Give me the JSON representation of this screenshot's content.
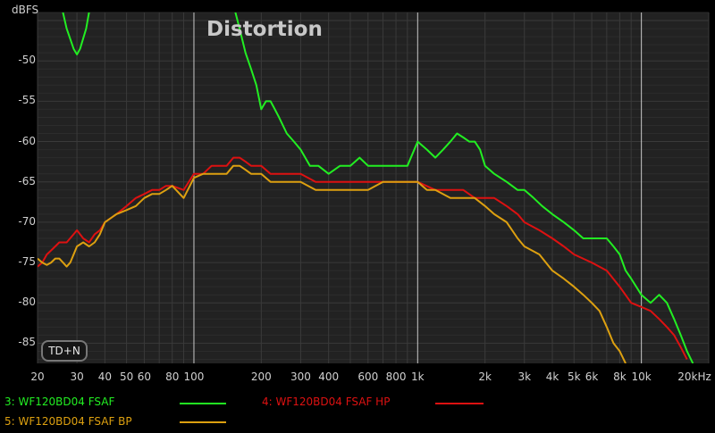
{
  "chart_data": {
    "type": "line",
    "title": "Distortion",
    "ylabel": "dBFS",
    "xlabel": "",
    "x_scale": "log",
    "xlim": [
      20,
      20000
    ],
    "ylim": [
      -87.5,
      -44
    ],
    "y_ticks": [
      "-50",
      "-55",
      "-60",
      "-65",
      "-70",
      "-75",
      "-80",
      "-85"
    ],
    "x_ticks": [
      {
        "v": 20,
        "label": "20"
      },
      {
        "v": 30,
        "label": "30"
      },
      {
        "v": 40,
        "label": "40"
      },
      {
        "v": 50,
        "label": "50"
      },
      {
        "v": 60,
        "label": "60"
      },
      {
        "v": 80,
        "label": "80"
      },
      {
        "v": 100,
        "label": "100"
      },
      {
        "v": 200,
        "label": "200"
      },
      {
        "v": 300,
        "label": "300"
      },
      {
        "v": 400,
        "label": "400"
      },
      {
        "v": 600,
        "label": "600"
      },
      {
        "v": 800,
        "label": "800"
      },
      {
        "v": 1000,
        "label": "1k"
      },
      {
        "v": 2000,
        "label": "2k"
      },
      {
        "v": 3000,
        "label": "3k"
      },
      {
        "v": 4000,
        "label": "4k"
      },
      {
        "v": 5000,
        "label": "5k"
      },
      {
        "v": 6000,
        "label": "6k"
      },
      {
        "v": 8000,
        "label": "8k"
      },
      {
        "v": 10000,
        "label": "10k"
      },
      {
        "v": 20000,
        "label": "20kHz"
      }
    ],
    "grid": true,
    "legend_position": "bottom",
    "series": [
      {
        "name": "3: WF120BD04 FSAF",
        "color": "#22ee22",
        "x": [
          25,
          27,
          29,
          30,
          31,
          33,
          35,
          150,
          160,
          170,
          180,
          190,
          200,
          210,
          220,
          230,
          240,
          260,
          280,
          300,
          330,
          360,
          400,
          450,
          500,
          550,
          600,
          700,
          800,
          900,
          1000,
          1100,
          1200,
          1300,
          1400,
          1500,
          1600,
          1700,
          1800,
          1900,
          2000,
          2200,
          2500,
          2800,
          3000,
          3300,
          3600,
          4000,
          4500,
          5000,
          5500,
          6000,
          6500,
          7000,
          7500,
          8000,
          8500,
          9000,
          10000,
          11000,
          12000,
          13000,
          14000,
          15000,
          16000,
          17000
        ],
        "y": [
          -42,
          -46,
          -48.5,
          -49.2,
          -48.5,
          -46,
          -42,
          -43,
          -46,
          -49,
          -51,
          -53,
          -56,
          -55,
          -55,
          -56,
          -57,
          -59,
          -60,
          -61,
          -63,
          -63,
          -64,
          -63,
          -63,
          -62,
          -63,
          -63,
          -63,
          -63,
          -60,
          -61,
          -62,
          -61,
          -60,
          -59,
          -59.5,
          -60,
          -60,
          -61,
          -63,
          -64,
          -65,
          -66,
          -66,
          -67,
          -68,
          -69,
          -70,
          -71,
          -72,
          -72,
          -72,
          -72,
          -73,
          -74,
          -76,
          -77,
          -79,
          -80,
          -79,
          -80,
          -82,
          -84,
          -86,
          -87.5
        ]
      },
      {
        "name": "4: WF120BD04 FSAF HP",
        "color": "#dd1111",
        "x": [
          20,
          21,
          22,
          23,
          24,
          25,
          27,
          29,
          30,
          32,
          34,
          36,
          38,
          40,
          45,
          50,
          55,
          60,
          65,
          70,
          75,
          80,
          90,
          100,
          110,
          120,
          130,
          140,
          150,
          160,
          170,
          180,
          200,
          220,
          250,
          280,
          300,
          350,
          400,
          450,
          500,
          600,
          700,
          800,
          900,
          1000,
          1200,
          1400,
          1600,
          1800,
          2000,
          2200,
          2500,
          2800,
          3000,
          3500,
          4000,
          4500,
          5000,
          6000,
          7000,
          8000,
          9000,
          10000,
          11000,
          12000,
          13000,
          14000,
          15000,
          16000
        ],
        "y": [
          -75.5,
          -75,
          -74,
          -73.5,
          -73,
          -72.5,
          -72.5,
          -71.5,
          -71,
          -72,
          -72.5,
          -71.5,
          -71,
          -70,
          -69,
          -68,
          -67,
          -66.5,
          -66,
          -66,
          -65.5,
          -65.5,
          -66,
          -64,
          -64,
          -63,
          -63,
          -63,
          -62,
          -62,
          -62.5,
          -63,
          -63,
          -64,
          -64,
          -64,
          -64,
          -65,
          -65,
          -65,
          -65,
          -65,
          -65,
          -65,
          -65,
          -65,
          -66,
          -66,
          -66,
          -67,
          -67,
          -67,
          -68,
          -69,
          -70,
          -71,
          -72,
          -73,
          -74,
          -75,
          -76,
          -78,
          -80,
          -80.5,
          -81,
          -82,
          -83,
          -84,
          -85.5,
          -87
        ]
      },
      {
        "name": "5: WF120BD04 FSAF BP",
        "color": "#dda010",
        "x": [
          20,
          21,
          22,
          23,
          24,
          25,
          26,
          27,
          28,
          29,
          30,
          32,
          34,
          36,
          38,
          40,
          45,
          50,
          55,
          60,
          65,
          70,
          75,
          80,
          90,
          100,
          110,
          120,
          130,
          140,
          150,
          160,
          170,
          180,
          200,
          220,
          250,
          280,
          300,
          350,
          400,
          450,
          500,
          600,
          700,
          800,
          900,
          1000,
          1100,
          1200,
          1400,
          1600,
          1800,
          2000,
          2200,
          2500,
          2800,
          3000,
          3500,
          4000,
          4500,
          5000,
          5500,
          6000,
          6500,
          7000,
          7500,
          8000,
          8500
        ],
        "y": [
          -74.5,
          -75,
          -75.3,
          -75,
          -74.5,
          -74.5,
          -75,
          -75.5,
          -75,
          -74,
          -73,
          -72.5,
          -73,
          -72.5,
          -71.5,
          -70,
          -69,
          -68.5,
          -68,
          -67,
          -66.5,
          -66.5,
          -66,
          -65.5,
          -67,
          -64.5,
          -64,
          -64,
          -64,
          -64,
          -63,
          -63,
          -63.5,
          -64,
          -64,
          -65,
          -65,
          -65,
          -65,
          -66,
          -66,
          -66,
          -66,
          -66,
          -65,
          -65,
          -65,
          -65,
          -66,
          -66,
          -67,
          -67,
          -67,
          -68,
          -69,
          -70,
          -72,
          -73,
          -74,
          -76,
          -77,
          -78,
          -79,
          -80,
          -81,
          -83,
          -85,
          -86,
          -87.5
        ]
      }
    ]
  },
  "controls": {
    "tdn_label": "TD+N"
  }
}
